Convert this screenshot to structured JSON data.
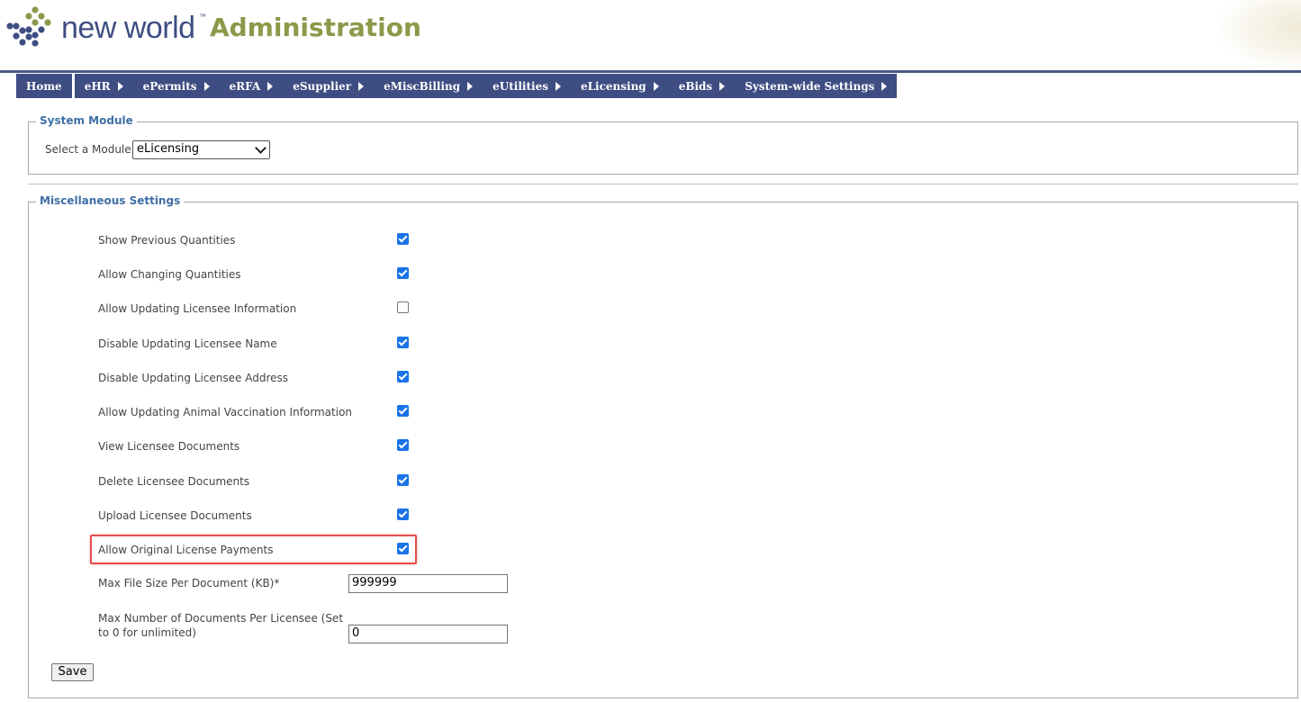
{
  "logo": {
    "brand": "new world",
    "tm": "™",
    "product": "Administration"
  },
  "nav": {
    "home": "Home",
    "items": [
      "eHR",
      "ePermits",
      "eRFA",
      "eSupplier",
      "eMiscBilling",
      "eUtilities",
      "eLicensing",
      "eBids",
      "System-wide Settings"
    ]
  },
  "system_module": {
    "legend": "System Module",
    "select_label": "Select a Module",
    "selected": "eLicensing"
  },
  "misc": {
    "legend": "Miscellaneous Settings",
    "settings": [
      {
        "label": "Show Previous Quantities",
        "checked": true
      },
      {
        "label": "Allow Changing Quantities",
        "checked": true
      },
      {
        "label": "Allow Updating Licensee Information",
        "checked": false
      },
      {
        "label": "Disable Updating Licensee Name",
        "checked": true
      },
      {
        "label": "Disable Updating Licensee Address",
        "checked": true
      },
      {
        "label": "Allow Updating Animal Vaccination Information",
        "checked": true
      },
      {
        "label": "View Licensee Documents",
        "checked": true
      },
      {
        "label": "Delete Licensee Documents",
        "checked": true
      },
      {
        "label": "Upload Licensee Documents",
        "checked": true
      },
      {
        "label": "Allow Original License Payments",
        "checked": true
      }
    ],
    "max_file_size_label": "Max File Size Per Document (KB)*",
    "max_file_size_value": "999999",
    "max_docs_label_line1": "Max Number of Documents Per Licensee (Set",
    "max_docs_label_line2": "to 0 for unlimited)",
    "max_docs_value": "0",
    "save_label": "Save"
  },
  "colors": {
    "nav_bg": "#3e4d82",
    "legend": "#3e6fa6",
    "checkbox": "#1a73e8",
    "highlight": "#e54b4b",
    "logo_green": "#8a9a4a"
  }
}
